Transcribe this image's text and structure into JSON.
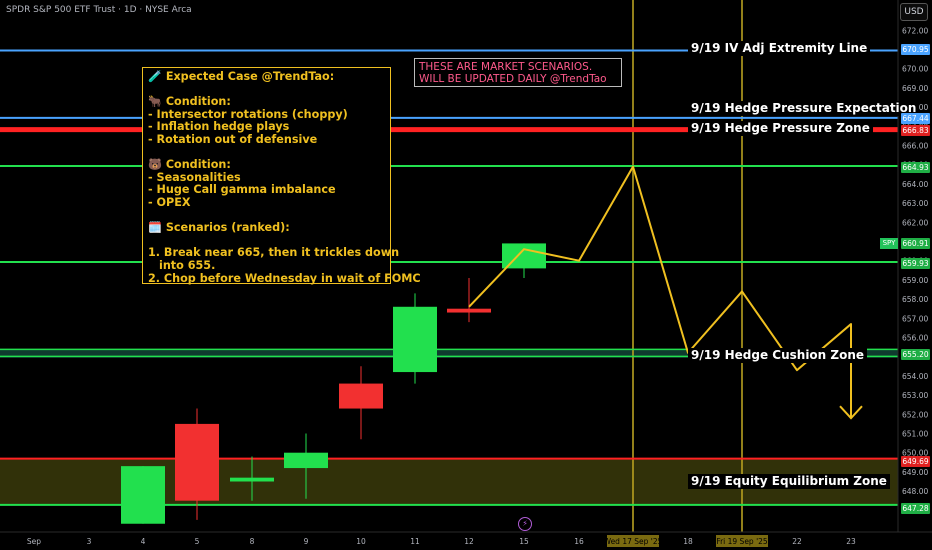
{
  "header": {
    "title": "SPDR S&P 500 ETF Trust · 1D · NYSE Arca",
    "currency_button": "USD"
  },
  "colors": {
    "background": "#000000",
    "up": "#22e04e",
    "down": "#f23030",
    "projection": "#f0c020",
    "level_blue": "#4aa3ff",
    "level_red": "#ff2222",
    "level_green": "#22e04e",
    "zone_fill": "#5a5a10"
  },
  "scenario_note": {
    "text": "THESE ARE MARKET SCENARIOS.\nWILL BE UPDATED DAILY @TrendTao"
  },
  "analysis_box": {
    "lines": [
      "🧪 Expected Case @TrendTao:",
      "",
      "🐂 Condition:",
      "- Intersector rotations (choppy)",
      "- Inflation hedge plays",
      "- Rotation out of defensive",
      "",
      "🐻 Condition:",
      "- Seasonalities",
      "- Huge Call gamma imbalance",
      "- OPEX",
      "",
      "🗓️ Scenarios (ranked):",
      "",
      "1. Break near 665, then it trickles down",
      "into 655.",
      "2. Chop before Wednesday in wait of FOMC"
    ]
  },
  "levels": {
    "iv_extremity": {
      "label": "9/19 IV Adj Extremity Line",
      "value": 670.95,
      "badge": "670.95",
      "color": "#4aa3ff"
    },
    "hedge_expectation": {
      "label": "9/19 Hedge Pressure Expectation",
      "value": 667.44,
      "badge": "667.44",
      "color": "#4aa3ff"
    },
    "hedge_zone": {
      "label": "9/19 Hedge Pressure Zone",
      "value": 666.83,
      "badge": "666.83",
      "color": "#ff2222"
    },
    "green_upper": {
      "value": 664.93,
      "badge": "664.93",
      "color": "#22e04e"
    },
    "green_mid": {
      "value": 659.93,
      "badge": "659.93",
      "color": "#22e04e"
    },
    "cushion": {
      "label": "9/19 Hedge Cushion Zone",
      "value": 655.2,
      "badge": "655.20",
      "color": "#22e04e"
    },
    "equity_top": {
      "value": 649.69,
      "badge": "649.69",
      "color": "#ff2222"
    },
    "equity_label": {
      "label": "9/19 Equity Equilibrium Zone"
    },
    "equity_bottom": {
      "value": 647.28,
      "badge": "647.28",
      "color": "#22e04e"
    },
    "spy_last": {
      "value": 660.91,
      "badge": "660.91",
      "tag": "SPY"
    }
  },
  "chart_data": {
    "type": "candlestick",
    "title": "SPDR S&P 500 ETF Trust · 1D · NYSE Arca",
    "y_axis": {
      "min": 646.3,
      "max": 672.5,
      "ticks": [
        647,
        648,
        649,
        650,
        651,
        652,
        653,
        654,
        655,
        656,
        657,
        658,
        659,
        660,
        661,
        662,
        663,
        664,
        665,
        666,
        667,
        668,
        669,
        670,
        671,
        672
      ]
    },
    "x_axis": {
      "ticks": [
        {
          "date": "2025-09-01",
          "label": "Sep"
        },
        {
          "date": "2025-09-03",
          "label": "3"
        },
        {
          "date": "2025-09-04",
          "label": "4"
        },
        {
          "date": "2025-09-05",
          "label": "5"
        },
        {
          "date": "2025-09-08",
          "label": "8"
        },
        {
          "date": "2025-09-09",
          "label": "9"
        },
        {
          "date": "2025-09-10",
          "label": "10"
        },
        {
          "date": "2025-09-11",
          "label": "11"
        },
        {
          "date": "2025-09-12",
          "label": "12"
        },
        {
          "date": "2025-09-15",
          "label": "15"
        },
        {
          "date": "2025-09-16",
          "label": "16"
        },
        {
          "date": "2025-09-17",
          "label": "Wed 17 Sep '25",
          "highlight": true
        },
        {
          "date": "2025-09-18",
          "label": "18"
        },
        {
          "date": "2025-09-19",
          "label": "Fri 19 Sep '25",
          "highlight": true
        },
        {
          "date": "2025-09-22",
          "label": "22"
        },
        {
          "date": "2025-09-23",
          "label": "23"
        }
      ]
    },
    "candles": [
      {
        "date": "2025-09-04",
        "open": 646.3,
        "high": 649.3,
        "low": 646.3,
        "close": 649.3
      },
      {
        "date": "2025-09-05",
        "open": 651.5,
        "high": 652.3,
        "low": 646.5,
        "close": 647.5
      },
      {
        "date": "2025-09-08",
        "open": 648.5,
        "high": 649.8,
        "low": 647.5,
        "close": 648.7
      },
      {
        "date": "2025-09-09",
        "open": 649.2,
        "high": 651.0,
        "low": 647.6,
        "close": 650.0
      },
      {
        "date": "2025-09-10",
        "open": 653.6,
        "high": 654.5,
        "low": 650.7,
        "close": 652.3
      },
      {
        "date": "2025-09-11",
        "open": 654.2,
        "high": 658.3,
        "low": 653.6,
        "close": 657.6
      },
      {
        "date": "2025-09-12",
        "open": 657.5,
        "high": 659.1,
        "low": 656.8,
        "close": 657.3
      },
      {
        "date": "2025-09-15",
        "open": 659.6,
        "high": 660.9,
        "low": 659.1,
        "close": 660.9
      }
    ],
    "projection": {
      "points": [
        {
          "date": "2025-09-12",
          "value": 657.6
        },
        {
          "date": "2025-09-15",
          "value": 660.6
        },
        {
          "date": "2025-09-16",
          "value": 660.0
        },
        {
          "date": "2025-09-17",
          "value": 664.9
        },
        {
          "date": "2025-09-18",
          "value": 655.2
        },
        {
          "date": "2025-09-19",
          "value": 658.4
        },
        {
          "date": "2025-09-22",
          "value": 654.3
        },
        {
          "date": "2025-09-23",
          "value": 656.7
        },
        {
          "date": "2025-09-23",
          "value": 651.8
        }
      ]
    }
  }
}
